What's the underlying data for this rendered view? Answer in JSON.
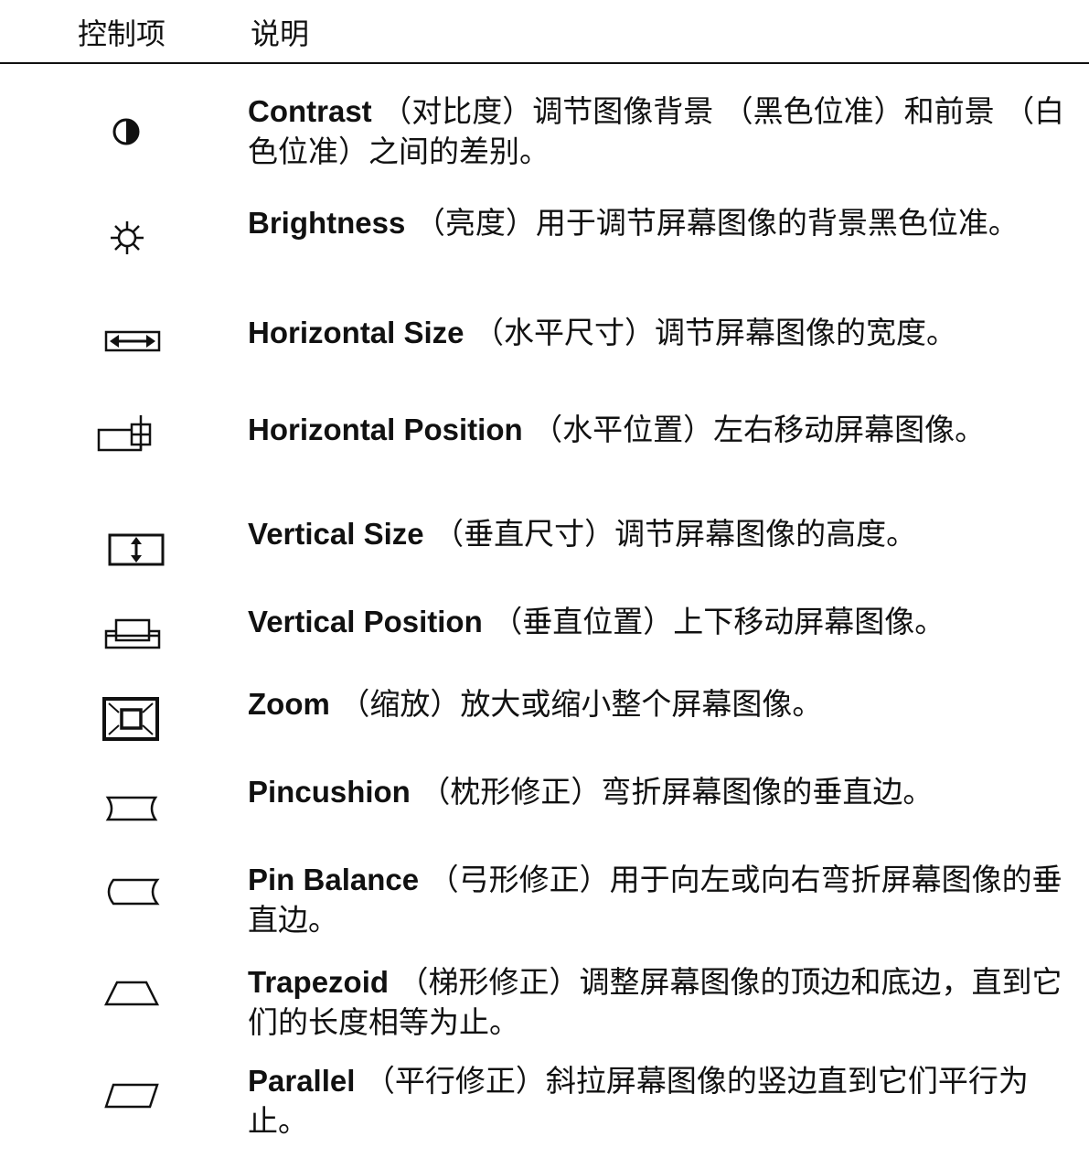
{
  "header": {
    "col1": "控制项",
    "col2": "说明"
  },
  "rows": [
    {
      "icon": "contrast-icon",
      "term": "Contrast",
      "paren": "（对比度）",
      "text": "调节图像背景 （黑色位准）和前景 （白色位准）之间的差别。"
    },
    {
      "icon": "brightness-icon",
      "term": "Brightness",
      "paren": "（亮度）",
      "text": "用于调节屏幕图像的背景黑色位准。"
    },
    {
      "icon": "horizontal-size-icon",
      "term": "Horizontal Size",
      "paren": "（水平尺寸）",
      "text": "调节屏幕图像的宽度。"
    },
    {
      "icon": "horizontal-position-icon",
      "term": "Horizontal Position",
      "paren": "（水平位置）",
      "text": "左右移动屏幕图像。"
    },
    {
      "icon": "vertical-size-icon",
      "term": "Vertical Size",
      "paren": "（垂直尺寸）",
      "text": "调节屏幕图像的高度。"
    },
    {
      "icon": "vertical-position-icon",
      "term": "Vertical Position",
      "paren": "（垂直位置）",
      "text": "上下移动屏幕图像。"
    },
    {
      "icon": "zoom-icon",
      "term": "Zoom",
      "paren": "（缩放）",
      "text": "放大或缩小整个屏幕图像。"
    },
    {
      "icon": "pincushion-icon",
      "term": "Pincushion",
      "paren": "（枕形修正）",
      "text": "弯折屏幕图像的垂直边。"
    },
    {
      "icon": "pin-balance-icon",
      "term": "Pin Balance",
      "paren": "（弓形修正）",
      "text": "用于向左或向右弯折屏幕图像的垂直边。"
    },
    {
      "icon": "trapezoid-icon",
      "term": "Trapezoid",
      "paren": "（梯形修正）",
      "text": "调整屏幕图像的顶边和底边，直到它们的长度相等为止。"
    },
    {
      "icon": "parallel-icon",
      "term": "Parallel",
      "paren": "（平行修正）",
      "text": "斜拉屏幕图像的竖边直到它们平行为止。"
    }
  ]
}
